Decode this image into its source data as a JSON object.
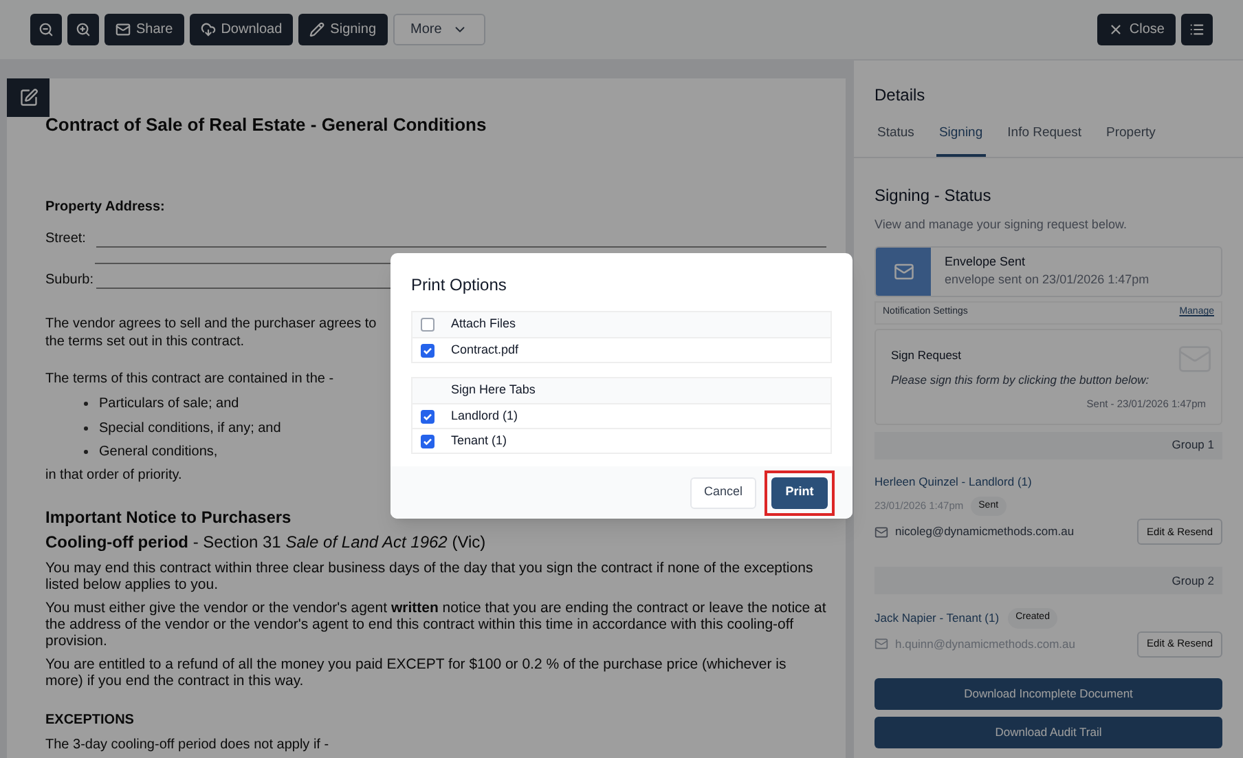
{
  "toolbar": {
    "buttons": [
      {
        "kind": "zoom-out"
      },
      {
        "kind": "zoom-in"
      },
      {
        "kind": "share",
        "label": "Share"
      },
      {
        "kind": "download",
        "label": "Download"
      },
      {
        "kind": "signing",
        "label": "Signing"
      },
      {
        "kind": "more",
        "label": "More"
      }
    ],
    "right": [
      {
        "kind": "close",
        "label": "Close"
      },
      {
        "kind": "list"
      }
    ]
  },
  "document": {
    "title": "Contract of Sale of Real Estate - General Conditions",
    "address_label": "Property Address:",
    "street_label": "Street:",
    "suburb_label": "Suburb:",
    "intro": "The vendor agrees to sell and the purchaser agrees to",
    "intro_2": "the terms set out in this contract.",
    "terms_lead": "The terms of this contract are contained in the -",
    "terms": [
      "Particulars of sale; and",
      "Special conditions, if any; and",
      "General conditions,"
    ],
    "terms_end": "in that order of priority.",
    "notice_heading": "Important Notice to Purchasers",
    "cooling_heading": "Cooling-off period",
    "cooling_rest": " - Section 31 *Sale of Land Act 1962* (Vic)",
    "paragraphs": [
      "You may end this contract within three clear business days of the day that you sign the contract if none of the exceptions listed below applies to you.",
      "You must either give the vendor or the vendor's agent **written** notice that you are ending the contract or leave the notice at the address of the vendor or the vendor's agent to end this contract within this time in accordance with this cooling-off provision.",
      "You are entitled to a refund of all the money you paid EXCEPT for $100 or 0.2 % of the purchase price (whichever is more) if you end the contract in this way."
    ],
    "exceptions_heading": "EXCEPTIONS",
    "exceptions_lead": "The 3-day cooling-off period does not apply if -"
  },
  "details": {
    "title": "Details",
    "tabs": [
      {
        "label": "Status",
        "selected": false
      },
      {
        "label": "Signing",
        "selected": true
      },
      {
        "label": "Info Request",
        "selected": false
      },
      {
        "label": "Property",
        "selected": false
      }
    ],
    "section_title": "Signing - Status",
    "section_desc": "View and manage your signing request below.",
    "envelope": {
      "title": "Envelope Sent",
      "subtitle": "envelope sent on 23/01/2026 1:47pm"
    },
    "notification": {
      "label": "Notification Settings",
      "link": "Manage"
    },
    "sign_request": {
      "title": "Sign Request",
      "message": "Please sign this form by clicking the button below:",
      "sent": "Sent - 23/01/2026 1:47pm"
    },
    "groups": [
      {
        "label": "Group 1",
        "signer": {
          "name": "Herleen Quinzel - Landlord (1)",
          "date": "23/01/2026 1:47pm",
          "badge": "Sent",
          "email": "nicoleg@dynamicmethods.com.au",
          "dimmed": false,
          "button": "Edit & Resend"
        }
      },
      {
        "label": "Group 2",
        "signer": {
          "name": "Jack Napier - Tenant (1)",
          "badge": "Created",
          "email": "h.quinn@dynamicmethods.com.au",
          "dimmed": true,
          "button": "Edit & Resend"
        }
      }
    ],
    "actions": [
      "Download Incomplete Document",
      "Download Audit Trail"
    ]
  },
  "dialog": {
    "title": "Print Options",
    "sections": [
      {
        "header": {
          "label": "Attach Files",
          "kind": "checkbox",
          "checked": false
        },
        "items": [
          {
            "label": "Contract.pdf",
            "checked": true
          }
        ]
      },
      {
        "header": {
          "label": "Sign Here Tabs",
          "kind": "plain"
        },
        "items": [
          {
            "label": "Landlord (1)",
            "checked": true
          },
          {
            "label": "Tenant (1)",
            "checked": true
          }
        ]
      }
    ],
    "cancel": "Cancel",
    "print": "Print",
    "print_highlighted": true
  }
}
